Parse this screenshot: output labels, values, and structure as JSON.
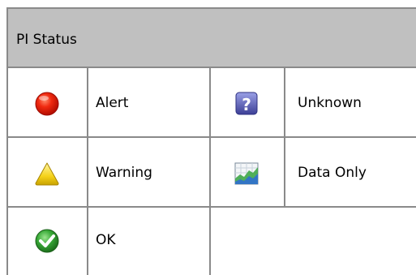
{
  "title": "PI Status",
  "rows": [
    {
      "left_icon": "alert-red-circle-icon",
      "left_label": "Alert",
      "right_icon": "unknown-question-icon",
      "right_label": "Unknown"
    },
    {
      "left_icon": "warning-yellow-triangle-icon",
      "left_label": "Warning",
      "right_icon": "data-only-chart-icon",
      "right_label": "Data Only"
    },
    {
      "left_icon": "ok-green-check-icon",
      "left_label": "OK",
      "right_icon": "",
      "right_label": ""
    }
  ],
  "colors": {
    "header_bg": "#c0c0c0",
    "grid_line": "#8a8a8a",
    "alert": "#e81e0a",
    "warning": "#f3d91c",
    "ok": "#3ab03a",
    "unknown": "#5a5fb0"
  }
}
